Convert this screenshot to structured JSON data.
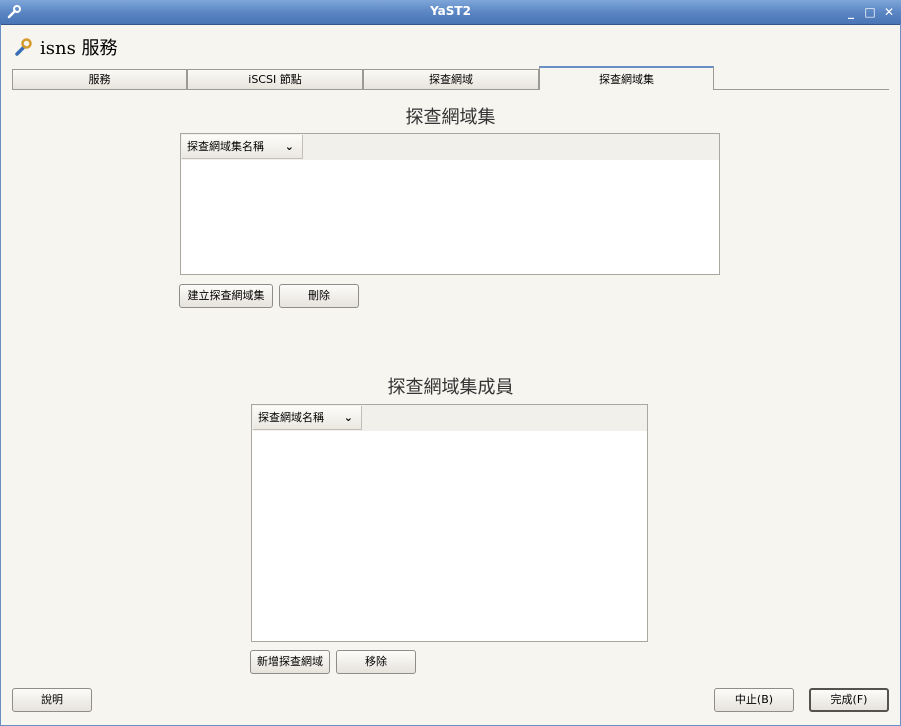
{
  "window": {
    "title": "YaST2"
  },
  "heading": {
    "text": "isns  服務",
    "icon": "wrench-icon"
  },
  "tabs": [
    {
      "label": "服務"
    },
    {
      "label": "iSCSI 節點"
    },
    {
      "label": "探查網域"
    },
    {
      "label": "探查網域集"
    }
  ],
  "active_tab": 3,
  "sets_section": {
    "title": "探查網域集",
    "column_header": "探查網域集名稱",
    "create_button": "建立探查網域集",
    "delete_button": "刪除"
  },
  "members_section": {
    "title": "探查網域集成員",
    "column_header": "探查網域名稱",
    "add_button": "新增探查網域",
    "remove_button": "移除"
  },
  "footer": {
    "help_button": "說明",
    "abort_button": "中止(B)",
    "finish_button": "完成(F)"
  }
}
